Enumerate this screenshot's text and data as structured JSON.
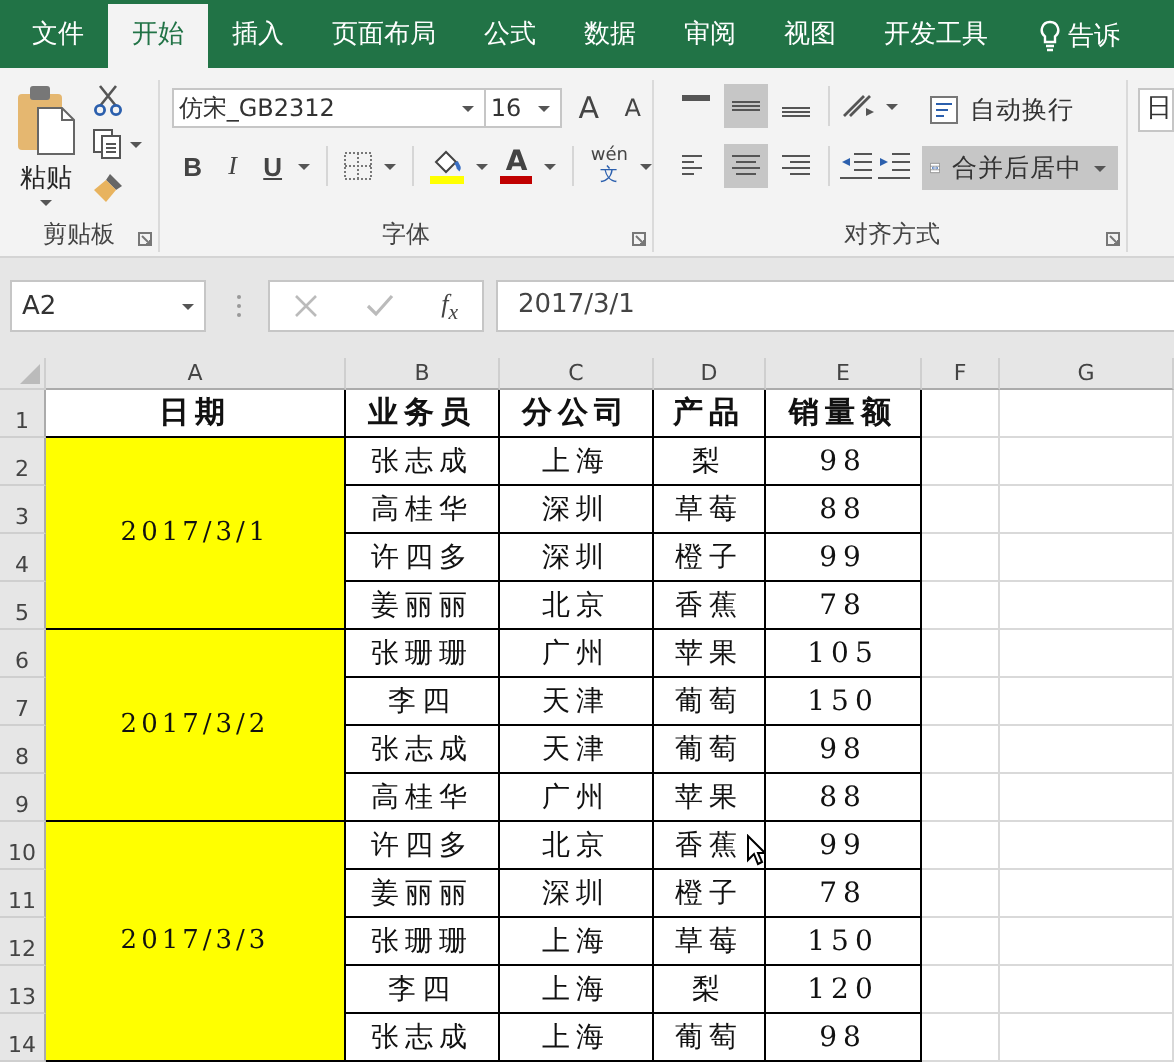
{
  "ribbon_tabs": [
    {
      "label": "文件",
      "selected": false
    },
    {
      "label": "开始",
      "selected": true
    },
    {
      "label": "插入",
      "selected": false
    },
    {
      "label": "页面布局",
      "selected": false
    },
    {
      "label": "公式",
      "selected": false
    },
    {
      "label": "数据",
      "selected": false
    },
    {
      "label": "审阅",
      "selected": false
    },
    {
      "label": "视图",
      "selected": false
    },
    {
      "label": "开发工具",
      "selected": false
    }
  ],
  "tell_me": {
    "label": "告诉"
  },
  "clipboard": {
    "paste_label": "粘贴",
    "group_label": "剪贴板"
  },
  "font": {
    "name": "仿宋_GB2312",
    "size": "16",
    "grow": "A",
    "shrink": "A",
    "bold": "B",
    "italic": "I",
    "underline": "U",
    "font_color": "A",
    "phonetic_top": "wén",
    "phonetic_bottom": "文",
    "group_label": "字体"
  },
  "alignment": {
    "vertical": [
      {
        "selected": false
      },
      {
        "selected": true
      },
      {
        "selected": false
      }
    ],
    "horizontal": [
      {
        "selected": false
      },
      {
        "selected": true
      },
      {
        "selected": false
      }
    ],
    "wrap_label": "自动换行",
    "merge_label": "合并后居中",
    "merge_selected": true,
    "group_label": "对齐方式"
  },
  "number_format": {
    "value": "日"
  },
  "formula_bar": {
    "name_box": "A2",
    "function_label": "f$_{x}$",
    "formula": "2017/3/1"
  },
  "columns": [
    "A",
    "B",
    "C",
    "D",
    "E",
    "F",
    "G"
  ],
  "row_numbers": [
    "1",
    "2",
    "3",
    "4",
    "5",
    "6",
    "7",
    "8",
    "9",
    "10",
    "11",
    "12",
    "13",
    "14"
  ],
  "header": [
    "日期",
    "业务员",
    "分公司",
    "产品",
    "销量额"
  ],
  "groups": [
    {
      "date": "2017/3/1",
      "rows": [
        [
          "张志成",
          "上海",
          "梨",
          "98"
        ],
        [
          "高桂华",
          "深圳",
          "草莓",
          "88"
        ],
        [
          "许四多",
          "深圳",
          "橙子",
          "99"
        ],
        [
          "姜丽丽",
          "北京",
          "香蕉",
          "78"
        ]
      ]
    },
    {
      "date": "2017/3/2",
      "rows": [
        [
          "张珊珊",
          "广州",
          "苹果",
          "105"
        ],
        [
          "李四",
          "天津",
          "葡萄",
          "150"
        ],
        [
          "张志成",
          "天津",
          "葡萄",
          "98"
        ],
        [
          "高桂华",
          "广州",
          "苹果",
          "88"
        ]
      ]
    },
    {
      "date": "2017/3/3",
      "rows": [
        [
          "许四多",
          "北京",
          "香蕉",
          "99"
        ],
        [
          "姜丽丽",
          "深圳",
          "橙子",
          "78"
        ],
        [
          "张珊珊",
          "上海",
          "草莓",
          "150"
        ],
        [
          "李四",
          "上海",
          "梨",
          "120"
        ],
        [
          "张志成",
          "上海",
          "葡萄",
          "98"
        ]
      ]
    }
  ]
}
